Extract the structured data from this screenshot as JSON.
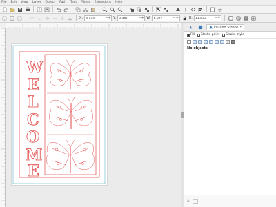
{
  "menubar": {
    "items": [
      "File",
      "Edit",
      "View",
      "Layer",
      "Object",
      "Path",
      "Text",
      "Filters",
      "Extensions",
      "Help"
    ]
  },
  "toolbar": {
    "buttons": [
      "new-doc",
      "open",
      "save",
      "print",
      "import",
      "export",
      "undo",
      "redo",
      "copy",
      "cut",
      "paste",
      "zoom-selection",
      "zoom-drawing",
      "zoom-page",
      "duplicate",
      "clone",
      "unlink-clone",
      "group",
      "ungroup",
      "fill-stroke",
      "text-font",
      "xml-editor",
      "align-distribute",
      "document-properties",
      "preferences"
    ]
  },
  "controlbar": {
    "x_label": "X:",
    "x_value": "3.733",
    "y_label": "Y:",
    "y_value": "5.387",
    "w_label": "W:",
    "w_value": "8.627",
    "h_label": "H:",
    "h_value": "11.835",
    "unit": "in"
  },
  "canvas": {
    "artwork_text": "WELCOME",
    "page_bg": "#ffffff",
    "line_color": "#e24a4a",
    "guide_color": "#3aa6b0"
  },
  "panel": {
    "tabs": [
      "Fill and Stroke"
    ],
    "active_tab": "Fill and Stroke",
    "subtabs": [
      "Fill",
      "Stroke paint",
      "Stroke style"
    ],
    "status": "No objects",
    "bottom_label": "A:"
  },
  "colors": {
    "accent": "#3d7ab8",
    "design": "#e24a4a"
  }
}
